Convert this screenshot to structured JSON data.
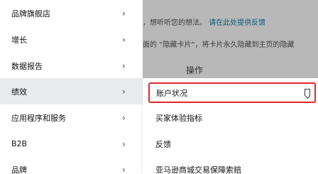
{
  "background": {
    "line1_text": "，想听听您的想法。",
    "line1_link": "请在此处提供反馈",
    "line2_text": "面的 “隐藏卡片”，将卡片永久隐藏到主页的隐藏",
    "header": "操作"
  },
  "menu": {
    "items": [
      {
        "label": "品牌旗舰店",
        "chevron": "›"
      },
      {
        "label": "增长",
        "chevron": "›"
      },
      {
        "label": "数据报告",
        "chevron": "›"
      },
      {
        "label": "绩效",
        "chevron": "›"
      },
      {
        "label": "应用程序和服务",
        "chevron": "›"
      },
      {
        "label": "B2B",
        "chevron": "›"
      },
      {
        "label": "品牌",
        "chevron": "›"
      }
    ]
  },
  "submenu": {
    "items": [
      {
        "label": "账户状况"
      },
      {
        "label": "买家体验指标"
      },
      {
        "label": "反馈"
      },
      {
        "label": "亚马逊商城交易保障索赔"
      }
    ]
  },
  "colors": {
    "highlight_border": "#e4252a",
    "link": "#0a7fa6",
    "active_bg": "#e9eaec"
  }
}
